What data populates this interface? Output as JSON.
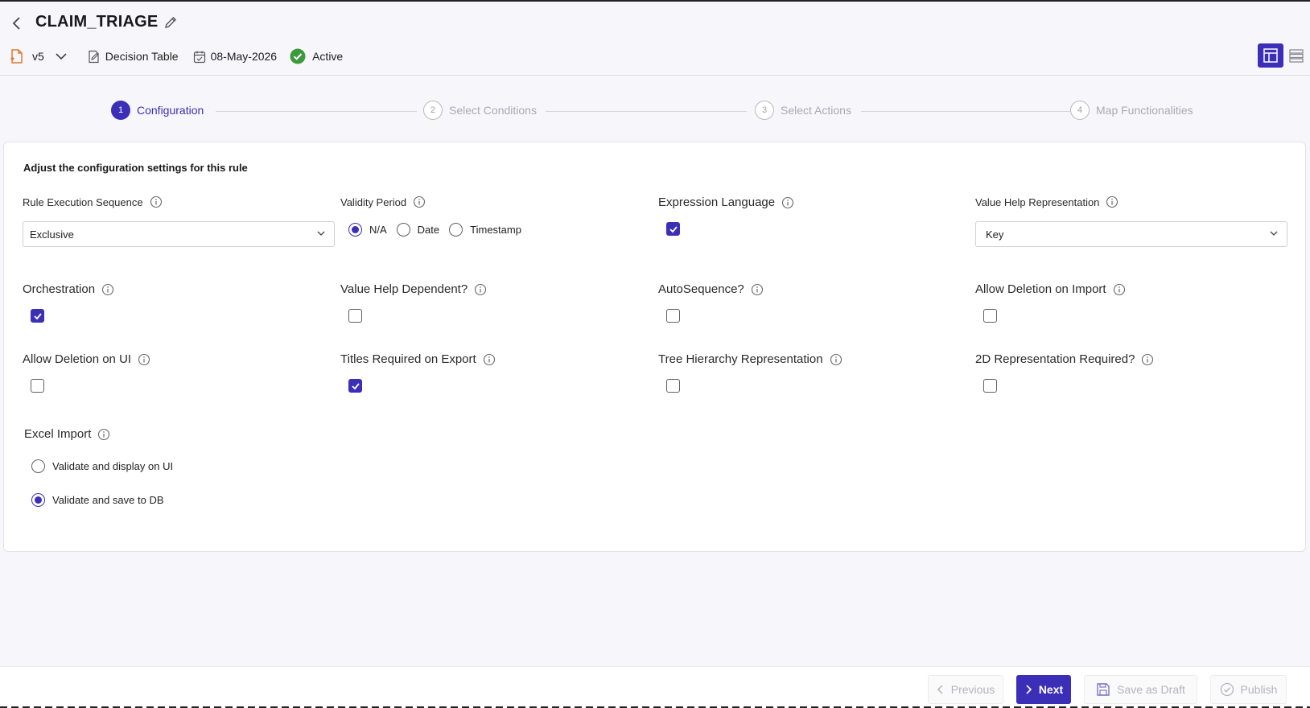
{
  "header": {
    "title": "CLAIM_TRIAGE",
    "version": "v5",
    "rule_type": "Decision Table",
    "date": "08-May-2026",
    "status": "Active"
  },
  "stepper": {
    "steps": [
      {
        "num": "1",
        "label": "Configuration",
        "active": true
      },
      {
        "num": "2",
        "label": "Select Conditions",
        "active": false
      },
      {
        "num": "3",
        "label": "Select Actions",
        "active": false
      },
      {
        "num": "4",
        "label": "Map Functionalities",
        "active": false
      }
    ]
  },
  "config": {
    "heading": "Adjust the configuration settings for this rule",
    "rule_execution_sequence": {
      "label": "Rule Execution Sequence",
      "value": "Exclusive"
    },
    "validity_period": {
      "label": "Validity Period",
      "options": [
        "N/A",
        "Date",
        "Timestamp"
      ],
      "selected": "N/A"
    },
    "expression_language": {
      "label": "Expression Language",
      "checked": true
    },
    "value_help_representation": {
      "label": "Value Help Representation",
      "value": "Key"
    },
    "orchestration": {
      "label": "Orchestration",
      "checked": true
    },
    "value_help_dependent": {
      "label": "Value Help Dependent?",
      "checked": false
    },
    "auto_sequence": {
      "label": "AutoSequence?",
      "checked": false
    },
    "allow_deletion_on_import": {
      "label": "Allow Deletion on Import",
      "checked": false
    },
    "allow_deletion_on_ui": {
      "label": "Allow Deletion on UI",
      "checked": false
    },
    "titles_required_on_export": {
      "label": "Titles Required on Export",
      "checked": true
    },
    "tree_hierarchy_representation": {
      "label": "Tree Hierarchy Representation",
      "checked": false
    },
    "two_d_representation_required": {
      "label": "2D Representation Required?",
      "checked": false
    },
    "excel_import": {
      "label": "Excel Import",
      "options": [
        "Validate and display on UI",
        "Validate and save to DB"
      ],
      "selected": "Validate and save to DB"
    }
  },
  "footer": {
    "previous": "Previous",
    "next": "Next",
    "save_draft": "Save as Draft",
    "publish": "Publish"
  },
  "colors": {
    "accent": "#3b2fb8",
    "success": "#3c9a3c",
    "version_icon": "#e07a2e"
  },
  "icons": [
    "back-icon",
    "edit-icon",
    "version-file-icon",
    "chevron-down-icon",
    "decision-table-icon",
    "calendar-icon",
    "active-check-icon",
    "table-view-icon",
    "list-view-icon",
    "info-icon",
    "save-icon",
    "publish-check-icon"
  ]
}
